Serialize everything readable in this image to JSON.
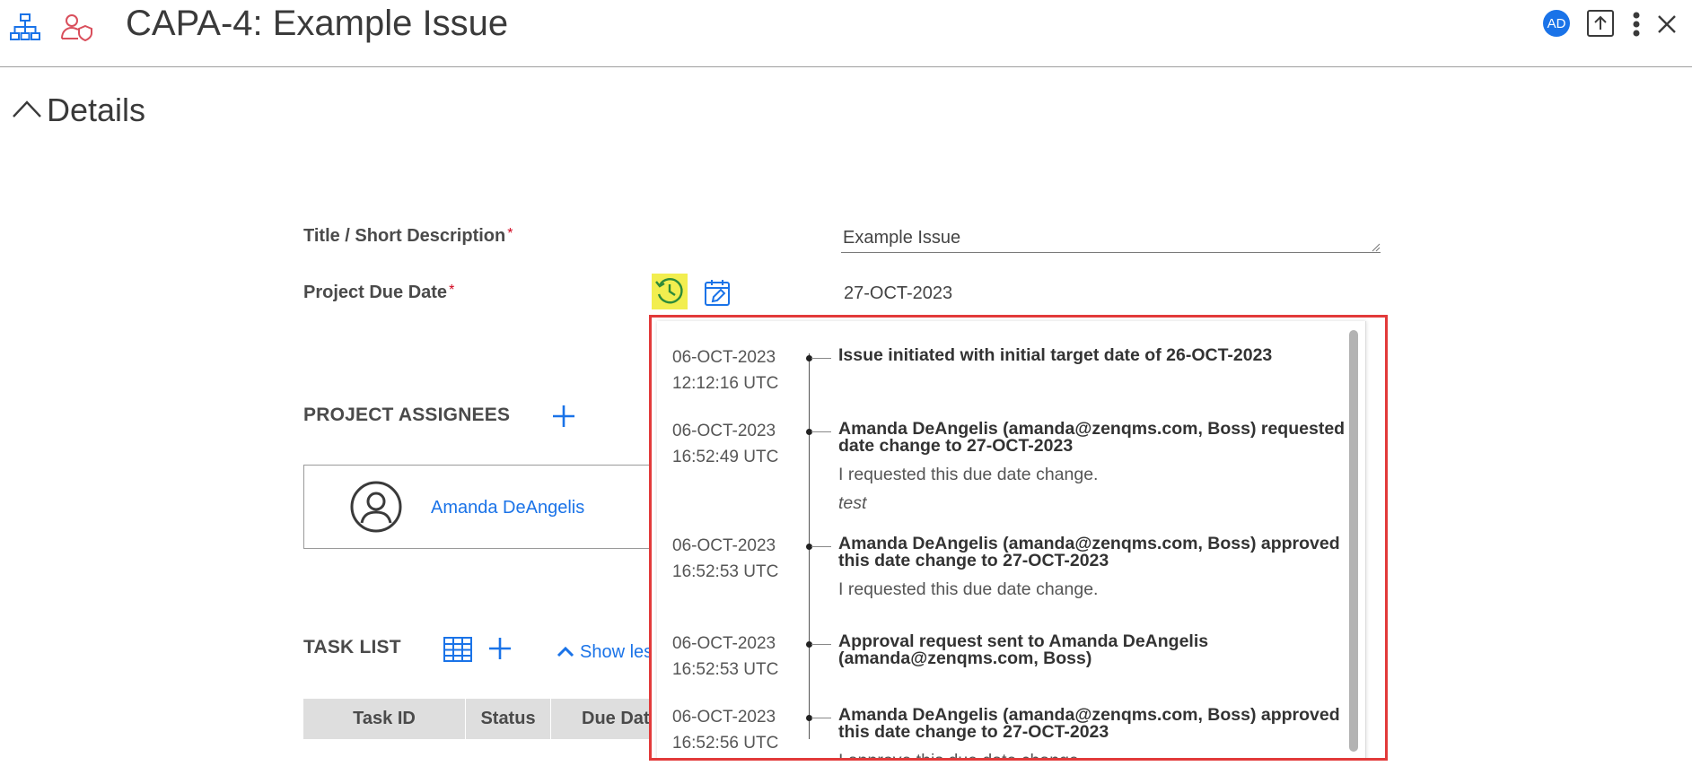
{
  "header": {
    "title": "CAPA-4: Example Issue",
    "avatar_initials": "AD",
    "hierarchy_icon": "hierarchy-icon",
    "user_shield_icon": "user-shield-icon",
    "upload_icon": "upload-icon",
    "more_icon": "more-vertical-icon",
    "close_icon": "close-icon"
  },
  "details": {
    "section_label": "Details",
    "title_field": {
      "label": "Title / Short Description",
      "required_mark": "*",
      "value": "Example Issue"
    },
    "due_date_field": {
      "label": "Project Due Date",
      "required_mark": "*",
      "value": "27-OCT-2023"
    }
  },
  "assignees": {
    "label": "PROJECT ASSIGNEES",
    "items": [
      {
        "name": "Amanda DeAngelis"
      }
    ]
  },
  "task_list": {
    "label": "TASK LIST",
    "show_less_label": "Show less",
    "columns": [
      "Task ID",
      "Status",
      "Due Date"
    ]
  },
  "history": {
    "entries": [
      {
        "date": "06-OCT-2023",
        "time": "12:12:16 UTC",
        "message": "Issue initiated with initial target date of 26-OCT-2023",
        "notes": []
      },
      {
        "date": "06-OCT-2023",
        "time": "16:52:49 UTC",
        "message": "Amanda DeAngelis (amanda@zenqms.com, Boss) requested date change to 27-OCT-2023",
        "notes": [
          "I requested this due date change."
        ],
        "italic_note": "test"
      },
      {
        "date": "06-OCT-2023",
        "time": "16:52:53 UTC",
        "message": "Amanda DeAngelis (amanda@zenqms.com, Boss) approved this date change to 27-OCT-2023",
        "notes": [
          "I requested this due date change."
        ]
      },
      {
        "date": "06-OCT-2023",
        "time": "16:52:53 UTC",
        "message": "Approval request sent to Amanda DeAngelis (amanda@zenqms.com, Boss)",
        "notes": []
      },
      {
        "date": "06-OCT-2023",
        "time": "16:52:56 UTC",
        "message": "Amanda DeAngelis (amanda@zenqms.com, Boss) approved this date change to 27-OCT-2023",
        "notes": [
          "I approve this due date change."
        ]
      }
    ]
  },
  "colors": {
    "accent": "#1a73e8",
    "required": "#d0021b",
    "highlight": "#f2ee4f",
    "popup_border": "#e23a3a",
    "user_shield": "#d94f5c"
  }
}
